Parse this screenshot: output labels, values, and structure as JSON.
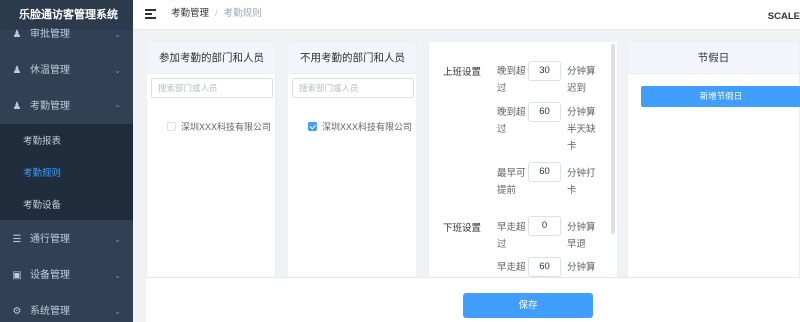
{
  "app": {
    "title": "乐脸通访客管理系统"
  },
  "header": {
    "breadcrumb": [
      "考勤管理",
      "考勤规则"
    ],
    "breadcrumb_sep": "/",
    "right_text": "SCALE"
  },
  "sidebar": {
    "items": [
      {
        "label": "审批管理",
        "icon": "user-icon"
      },
      {
        "label": "休温管理",
        "icon": "user-icon"
      },
      {
        "label": "考勤管理",
        "icon": "user-icon",
        "expanded": true,
        "children": [
          "考勤报表",
          "考勤规则",
          "考勤设备"
        ],
        "active_child": "考勤规则"
      },
      {
        "label": "通行管理",
        "icon": "list-icon"
      },
      {
        "label": "设备管理",
        "icon": "monitor-icon"
      },
      {
        "label": "系统管理",
        "icon": "gear-icon"
      }
    ]
  },
  "panels": {
    "included": {
      "title": "参加考勤的部门和人员",
      "search_placeholder": "搜索部门或人员",
      "tree": [
        {
          "label": "深圳XXX科技有限公司",
          "checked": false
        }
      ]
    },
    "excluded": {
      "title": "不用考勤的部门和人员",
      "search_placeholder": "搜索部门或人员",
      "tree": [
        {
          "label": "深圳XXX科技有限公司",
          "checked": true
        }
      ]
    }
  },
  "settings": {
    "on_duty": {
      "title": "上班设置",
      "rows": [
        {
          "label": "晚到超过",
          "value": "30",
          "unit": "分钟算迟到"
        },
        {
          "label": "晚到超过",
          "value": "60",
          "unit": "分钟算半天缺卡"
        },
        {
          "label": "最早可提前",
          "value": "60",
          "unit": "分钟打卡"
        }
      ]
    },
    "off_duty": {
      "title": "下班设置",
      "rows": [
        {
          "label": "早走超过",
          "value": "0",
          "unit": "分钟算早退"
        },
        {
          "label": "早走超过",
          "value": "60",
          "unit": "分钟算半天缺"
        }
      ]
    }
  },
  "holidays": {
    "title": "节假日",
    "add_button": "新增节假日"
  },
  "footer": {
    "save_button": "保存"
  },
  "colors": {
    "sidebar_bg": "#304156",
    "primary": "#409eff",
    "active_text": "#409eff"
  }
}
